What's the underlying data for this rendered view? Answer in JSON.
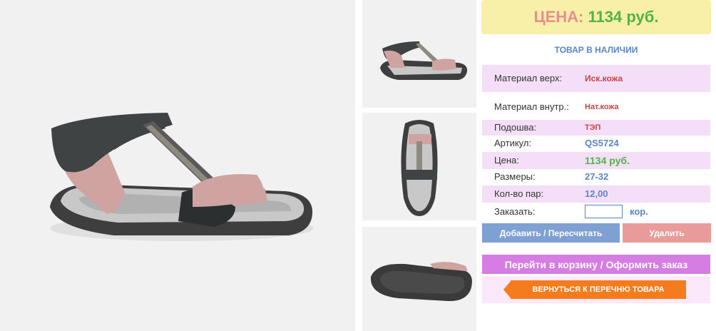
{
  "price_box": {
    "label": "ЦЕНА:",
    "value": "1134 руб."
  },
  "stock_status": "ТОВАР В НАЛИЧИИ",
  "specs": {
    "material_top": {
      "label": "Материал верх:",
      "value": "Иск.кожа"
    },
    "material_inner": {
      "label": "Материал внутр.:",
      "value": "Нат.кожа"
    },
    "sole": {
      "label": "Подошва:",
      "value": "ТЭП"
    },
    "article": {
      "label": "Артикул:",
      "value": "QS5724"
    },
    "price": {
      "label": "Цена:",
      "value": "1134 руб."
    },
    "sizes": {
      "label": "Размеры:",
      "value": "27-32"
    },
    "pairs": {
      "label": "Кол-во пар:",
      "value": "12,00"
    }
  },
  "order": {
    "label": "Заказать:",
    "value": "",
    "unit": "кор."
  },
  "buttons": {
    "add": "Добавить / Пересчитать",
    "delete": "Удалить",
    "cart": "Перейти в корзину / Оформить заказ",
    "back": "ВЕРНУТЬСЯ К ПЕРЕЧНЮ ТОВАРА"
  },
  "icons": {
    "back_arrow": "arrow-left-icon"
  },
  "colors": {
    "price_box_bg": "#f8f0a8",
    "price_label": "#e98d8d",
    "price_value": "#52b34a",
    "accent_blue": "#5b85c7",
    "accent_red": "#c64545",
    "row_pink": "#f5dff8",
    "btn_add": "#7fa0d2",
    "btn_delete": "#e99a9a",
    "btn_cart": "#d67de3",
    "btn_back": "#f47c1c"
  }
}
